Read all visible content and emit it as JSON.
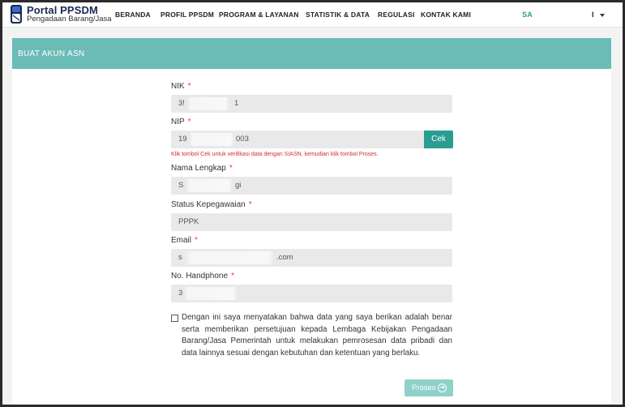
{
  "header": {
    "brand_title": "Portal PPSDM",
    "brand_subtitle": "Pengadaan Barang/Jasa",
    "nav": [
      "BERANDA",
      "PROFIL PPSDM",
      "PROGRAM & LAYANAN",
      "STATISTIK & DATA",
      "REGULASI",
      "KONTAK KAMI"
    ],
    "user_start": "SA",
    "user_end": "I"
  },
  "form": {
    "title": "BUAT AKUN ASN",
    "required_mark": "*",
    "fields": {
      "nik": {
        "label": "NIK",
        "value_start": "3!",
        "value_end": "1"
      },
      "nip": {
        "label": "NIP",
        "value_start": "19",
        "value_end": "003"
      },
      "nama": {
        "label": "Nama Lengkap",
        "value_start": "S",
        "value_end": "gi"
      },
      "status": {
        "label": "Status Kepegawaian",
        "value": "PPPK"
      },
      "email": {
        "label": "Email",
        "value_start": "s",
        "value_end": ".com"
      },
      "phone": {
        "label": "No. Handphone",
        "value_start": "3"
      }
    },
    "cek_label": "Cek",
    "nip_hint": "Klik tombol Cek untuk verifikasi data dengan SIASN, kemudian klik tombol Proses.",
    "agreement": "Dengan ini saya menyatakan bahwa data yang saya berikan adalah benar serta memberikan persetujuan kepada Lembaga Kebijakan Pengadaan Barang/Jasa Pemerintah untuk melakukan pemrosesan data pribadi dan data lainnya sesuai dengan kebutuhan dan ketentuan yang berlaku.",
    "submit_label": "Proses"
  },
  "colors": {
    "accent": "#2a9d91",
    "header_band": "#6bbcb6",
    "required": "#e53935"
  }
}
